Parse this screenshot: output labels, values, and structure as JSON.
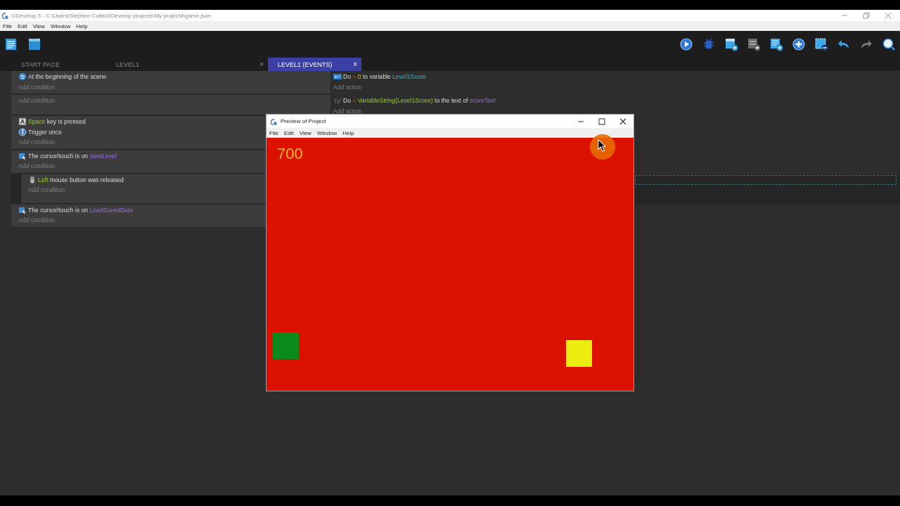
{
  "window": {
    "title": "GDevelop 5 - C:\\Users\\Stephen Cutts\\GDevelop projects\\My project4\\game.json"
  },
  "menu": [
    "File",
    "Edit",
    "View",
    "Window",
    "Help"
  ],
  "tabs": [
    {
      "label": "START PAGE",
      "closable": false,
      "selected": false
    },
    {
      "label": "LEVEL1",
      "closable": true,
      "selected": false
    },
    {
      "label": "LEVEL1 (EVENTS)",
      "closable": true,
      "selected": true
    }
  ],
  "close_glyph": "×",
  "events": [
    {
      "conditions": [
        {
          "kind": "scene",
          "parts": [
            {
              "text": "At the beginning of the scene",
              "kind": "plain"
            }
          ]
        }
      ],
      "add_condition": "Add condition",
      "actions": [
        {
          "kind": "variable",
          "parts": [
            {
              "text": "Do ",
              "kind": "plain"
            },
            {
              "text": "= ",
              "kind": "operator"
            },
            {
              "text": "0",
              "kind": "number"
            },
            {
              "text": " to variable ",
              "kind": "plain"
            },
            {
              "text": "Level1Score",
              "kind": "variable"
            }
          ]
        }
      ],
      "add_action": "Add action"
    },
    {
      "add_condition": "Add condition",
      "actions": [
        {
          "kind": "text",
          "parts": [
            {
              "text": "Do ",
              "kind": "plain"
            },
            {
              "text": "= ",
              "kind": "operator"
            },
            {
              "text": "VariableString(Level1Score)",
              "kind": "param"
            },
            {
              "text": " to the text of ",
              "kind": "plain"
            },
            {
              "text": "scoreText",
              "kind": "object"
            }
          ]
        }
      ],
      "add_action": "Add action"
    },
    {
      "conditions": [
        {
          "kind": "keyboard",
          "parts": [
            {
              "text": "Space",
              "kind": "param"
            },
            {
              "text": " key is pressed",
              "kind": "plain"
            }
          ]
        },
        {
          "kind": "trigger",
          "parts": [
            {
              "text": "Trigger once",
              "kind": "plain"
            }
          ]
        }
      ],
      "add_condition": "Add condition"
    },
    {
      "conditions": [
        {
          "kind": "cursor",
          "parts": [
            {
              "text": "The cursor/touch is on ",
              "kind": "plain"
            },
            {
              "text": "NextLevel",
              "kind": "object"
            }
          ]
        }
      ],
      "add_condition": "Add condition",
      "children": [
        {
          "conditions": [
            {
              "kind": "mouse",
              "parts": [
                {
                  "text": "Left",
                  "kind": "param"
                },
                {
                  "text": " mouse button was released",
                  "kind": "plain"
                }
              ]
            }
          ],
          "add_condition": "Add condition"
        }
      ]
    },
    {
      "conditions": [
        {
          "kind": "cursor",
          "parts": [
            {
              "text": "The cursor/touch is on ",
              "kind": "plain"
            },
            {
              "text": "LoadSavedData",
              "kind": "object"
            }
          ]
        }
      ],
      "add_condition": "Add condition"
    }
  ],
  "preview": {
    "title": "Preview of Project",
    "menu": [
      "File",
      "Edit",
      "View",
      "Window",
      "Help"
    ],
    "score": "700"
  }
}
